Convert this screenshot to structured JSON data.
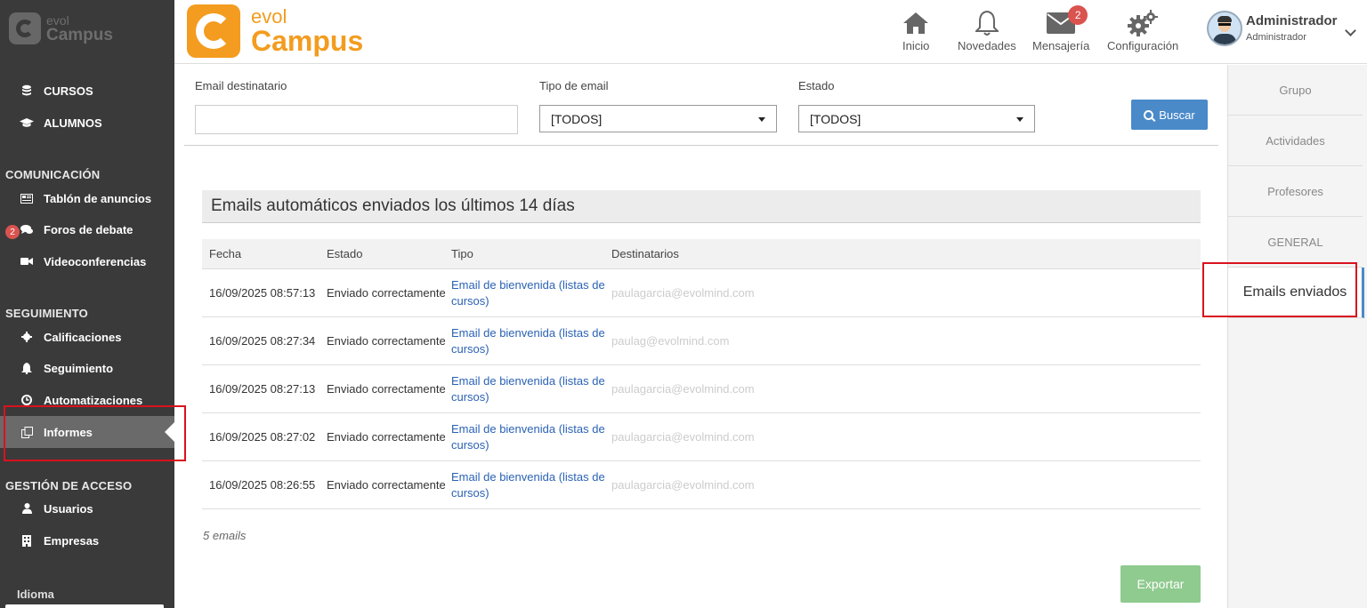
{
  "sidebar": {
    "logo": {
      "line1": "evol",
      "line2": "Campus"
    },
    "items_top": [
      {
        "label": "CURSOS",
        "icon": "database-icon"
      },
      {
        "label": "ALUMNOS",
        "icon": "graduation-cap-icon"
      }
    ],
    "sections": {
      "comunicacion": "COMUNICACIÓN",
      "seguimiento": "SEGUIMIENTO",
      "gestion": "GESTIÓN DE ACCESO"
    },
    "comunicacion_items": [
      {
        "label": "Tablón de anuncios"
      },
      {
        "label": "Foros de debate",
        "badge": "2"
      },
      {
        "label": "Videoconferencias"
      }
    ],
    "seguimiento_items": [
      {
        "label": "Calificaciones"
      },
      {
        "label": "Seguimiento"
      },
      {
        "label": "Automatizaciones"
      },
      {
        "label": "Informes"
      }
    ],
    "gestion_items": [
      {
        "label": "Usuarios"
      },
      {
        "label": "Empresas"
      }
    ],
    "language_label": "Idioma"
  },
  "header": {
    "brand": {
      "line1": "evol",
      "line2": "Campus"
    },
    "nav": {
      "inicio": "Inicio",
      "novedades": "Novedades",
      "mensajeria": "Mensajería",
      "mensajeria_badge": "2",
      "configuracion": "Configuración"
    },
    "user": {
      "name": "Administrador",
      "role": "Administrador"
    }
  },
  "filters": {
    "email_label": "Email destinatario",
    "email_value": "",
    "tipo_label": "Tipo de email",
    "tipo_value": "[TODOS]",
    "estado_label": "Estado",
    "estado_value": "[TODOS]",
    "search_button": "Buscar"
  },
  "panel": {
    "title": "Emails automáticos enviados los últimos 14 días",
    "columns": [
      "Fecha",
      "Estado",
      "Tipo",
      "Destinatarios"
    ],
    "rows": [
      {
        "fecha": "16/09/2025 08:57:13",
        "estado": "Enviado correctamente",
        "tipo": "Email de bienvenida (listas de cursos)",
        "dest": "paulagarcia@evolmind.com"
      },
      {
        "fecha": "16/09/2025 08:27:34",
        "estado": "Enviado correctamente",
        "tipo": "Email de bienvenida (listas de cursos)",
        "dest": "paulag@evolmind.com"
      },
      {
        "fecha": "16/09/2025 08:27:13",
        "estado": "Enviado correctamente",
        "tipo": "Email de bienvenida (listas de cursos)",
        "dest": "paulagarcia@evolmind.com"
      },
      {
        "fecha": "16/09/2025 08:27:02",
        "estado": "Enviado correctamente",
        "tipo": "Email de bienvenida (listas de cursos)",
        "dest": "paulagarcia@evolmind.com"
      },
      {
        "fecha": "16/09/2025 08:26:55",
        "estado": "Enviado correctamente",
        "tipo": "Email de bienvenida (listas de cursos)",
        "dest": "paulagarcia@evolmind.com"
      }
    ],
    "count": "5 emails",
    "export_button": "Exportar"
  },
  "right_tabs": [
    "Grupo",
    "Actividades",
    "Profesores",
    "GENERAL",
    "Emails enviados"
  ],
  "colors": {
    "accent": "#4a8ac9",
    "brand": "#f39c1f",
    "highlight": "#d9121e",
    "export": "#8fca8f"
  }
}
